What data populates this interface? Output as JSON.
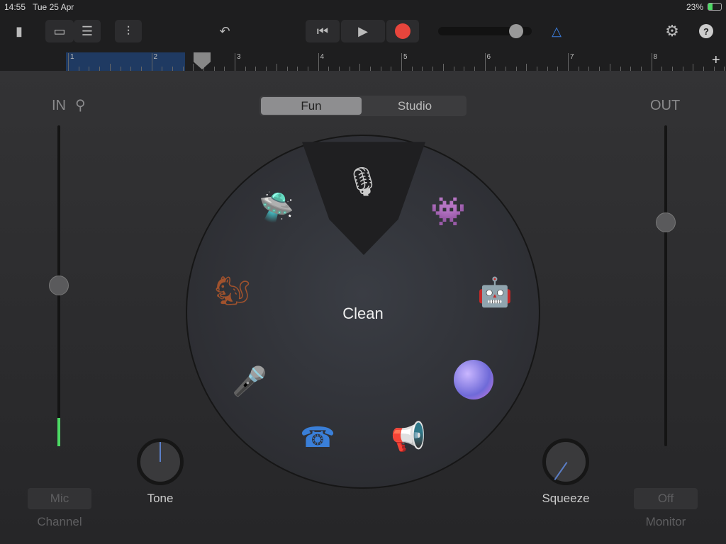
{
  "status": {
    "time": "14:55",
    "date": "Tue 25 Apr",
    "battery": "23%"
  },
  "toolbar": {
    "icons": [
      "document-icon",
      "tracks-view-icon",
      "list-view-icon",
      "mixer-icon",
      "undo-icon",
      "rewind-icon",
      "play-icon",
      "record-icon",
      "volume-slider",
      "metronome-icon",
      "settings-icon",
      "help-icon"
    ],
    "record_color": "#e8453c",
    "metronome_color": "#3b7ddd",
    "volume": 0.85
  },
  "ruler": {
    "bars": [
      "1",
      "2",
      "3",
      "4",
      "5",
      "6",
      "7",
      "8"
    ],
    "add": "+",
    "region_color": "#1f3a62"
  },
  "input": {
    "label": "IN",
    "level": 0.5,
    "channel_button": "Mic",
    "channel_label": "Channel"
  },
  "output": {
    "label": "OUT",
    "level": 0.72,
    "monitor_button": "Off",
    "monitor_label": "Monitor"
  },
  "mode": {
    "options": [
      "Fun",
      "Studio"
    ],
    "selected": "Fun"
  },
  "wheel": {
    "selected": "Clean",
    "voices": [
      "clean-mic",
      "ufo",
      "monster",
      "squirrel",
      "robot",
      "star-mic",
      "bubbles",
      "telephone",
      "megaphone"
    ]
  },
  "knobs": {
    "tone": {
      "label": "Tone",
      "value": 0.5
    },
    "squeeze": {
      "label": "Squeeze",
      "value": 0.1
    }
  }
}
